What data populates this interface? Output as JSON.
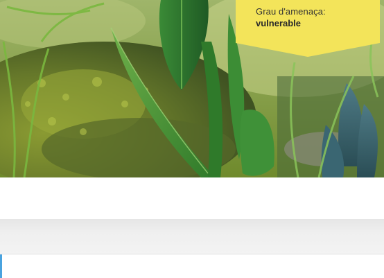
{
  "threat_badge": {
    "label": "Grau d'amenaça:",
    "value": "vulnerable",
    "background_color": "#f3e45a"
  },
  "hero_image": {
    "icon": "plant-photo"
  },
  "accent_color": "#4aa3df"
}
